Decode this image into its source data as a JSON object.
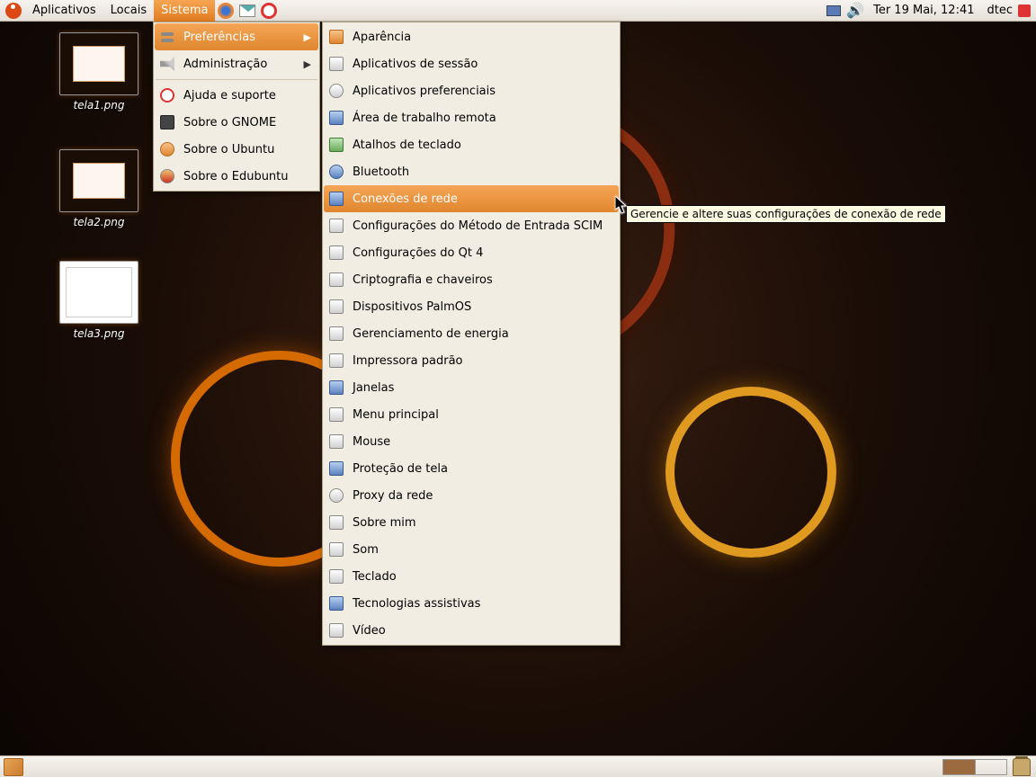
{
  "panel": {
    "menus": [
      "Aplicativos",
      "Locais",
      "Sistema"
    ],
    "active_menu": "Sistema",
    "clock": "Ter 19 Mai, 12:41",
    "user": "dtec"
  },
  "desktop_icons": [
    {
      "label": "tela1.png"
    },
    {
      "label": "tela2.png"
    },
    {
      "label": "tela3.png"
    }
  ],
  "system_menu": {
    "preferencias": "Preferências",
    "administracao": "Administração",
    "ajuda": "Ajuda e suporte",
    "sobre_gnome": "Sobre o GNOME",
    "sobre_ubuntu": "Sobre o Ubuntu",
    "sobre_edubuntu": "Sobre o Edubuntu"
  },
  "pref_menu": [
    "Aparência",
    "Aplicativos de sessão",
    "Aplicativos preferenciais",
    "Área de trabalho remota",
    "Atalhos de teclado",
    "Bluetooth",
    "Conexões de rede",
    "Configurações do Método de Entrada SCIM",
    "Configurações do Qt 4",
    "Criptografia e chaveiros",
    "Dispositivos PalmOS",
    "Gerenciamento de energia",
    "Impressora padrão",
    "Janelas",
    "Menu principal",
    "Mouse",
    "Proteção de tela",
    "Proxy da rede",
    "Sobre mim",
    "Som",
    "Teclado",
    "Tecnologias assistivas",
    "Vídeo"
  ],
  "pref_highlight_index": 6,
  "tooltip": "Gerencie e altere suas configurações de conexão de rede"
}
